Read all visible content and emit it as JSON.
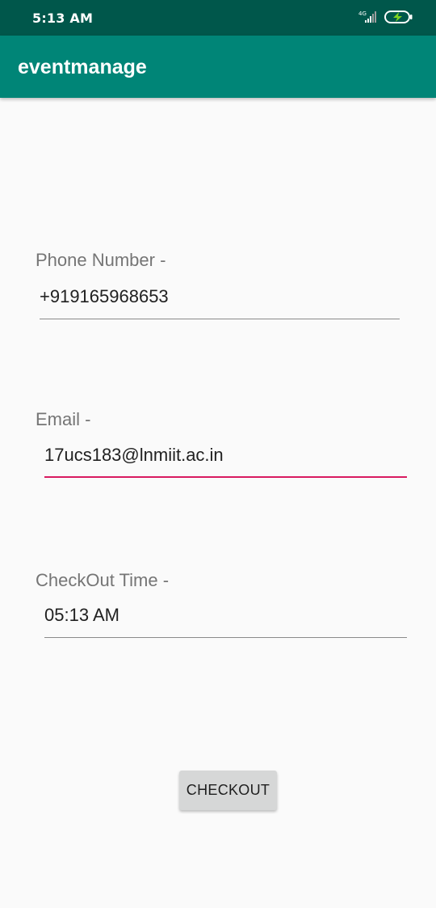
{
  "status_bar": {
    "time": "5:13 AM",
    "network_label": "4G",
    "icons": [
      "signal-icon",
      "battery-charging-icon"
    ]
  },
  "app_bar": {
    "title": "eventmanage",
    "color": "#008577"
  },
  "form": {
    "phone": {
      "label": "Phone Number -",
      "value": "+919165968653"
    },
    "email": {
      "label": "Email -",
      "value": "17ucs183@lnmiit.ac.in",
      "focused": true
    },
    "checkout_time": {
      "label": "CheckOut Time -",
      "value": "05:13 AM"
    },
    "checkout_button_label": "CHECKOUT"
  },
  "colors": {
    "status_bar": "#00574b",
    "accent": "#d81b60",
    "background": "#fafafa"
  }
}
